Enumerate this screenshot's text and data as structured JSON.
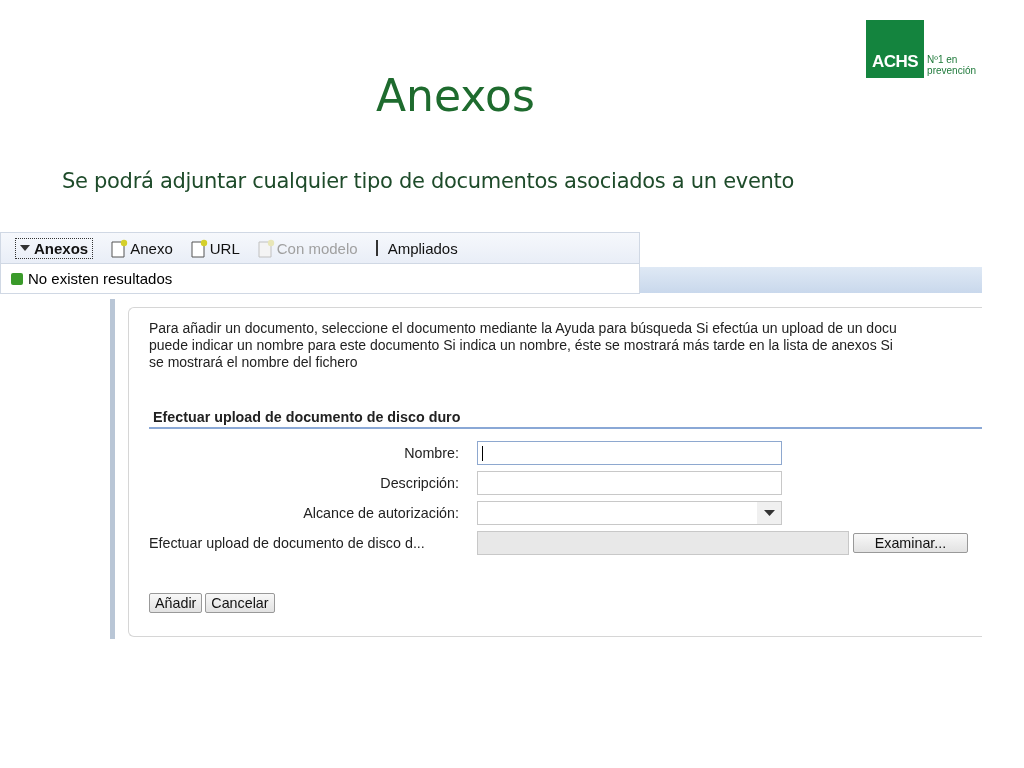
{
  "slide": {
    "title": "Anexos",
    "subtitle": "Se podrá adjuntar cualquier tipo de documentos asociados a un evento"
  },
  "logo": {
    "mark": "ACHS",
    "tagline": [
      "Nº1 en",
      "prevención"
    ]
  },
  "toolbar": {
    "section": {
      "label": "Anexos",
      "expanded": true
    },
    "items": [
      {
        "kind": "new",
        "label": "Anexo",
        "disabled": false
      },
      {
        "kind": "new",
        "label": "URL",
        "disabled": false
      },
      {
        "kind": "new",
        "label": "Con modelo",
        "disabled": true
      },
      {
        "kind": "link",
        "label": "Ampliados",
        "disabled": false
      }
    ],
    "message": "No existen resultados"
  },
  "dialog": {
    "intro": [
      "Para añadir un documento, seleccione el documento mediante la Ayuda para búsqueda Si efectúa un upload de un docu",
      "puede indicar un nombre para este documento Si indica un nombre, éste se mostrará más tarde en la lista de anexos Si",
      "se mostrará el nombre del fichero"
    ],
    "section_title": "Efectuar upload de documento de disco duro",
    "fields": [
      {
        "kind": "text",
        "label": "Nombre:",
        "focused": true
      },
      {
        "kind": "text",
        "label": "Descripción:",
        "focused": false
      },
      {
        "kind": "select",
        "label": "Alcance de autorización:",
        "focused": false
      },
      {
        "kind": "file",
        "label": "Efectuar upload de documento de disco d...",
        "button": "Examinar...",
        "focused": false
      }
    ],
    "buttons": [
      "Añadir",
      "Cancelar"
    ]
  }
}
